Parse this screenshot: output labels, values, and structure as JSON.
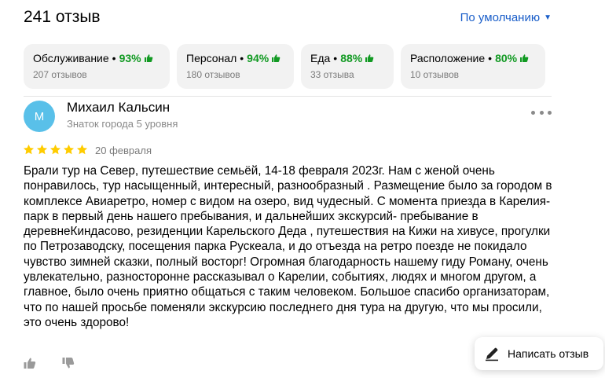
{
  "header": {
    "count_title": "241 отзыв",
    "sort_label": "По умолчанию"
  },
  "categories": [
    {
      "name": "Обслуживание",
      "percent": "93%",
      "count": "207 отзывов"
    },
    {
      "name": "Персонал",
      "percent": "94%",
      "count": "180 отзывов"
    },
    {
      "name": "Еда",
      "percent": "88%",
      "count": "33 отзыва"
    },
    {
      "name": "Расположение",
      "percent": "80%",
      "count": "10 отзывов"
    }
  ],
  "review": {
    "avatar_letter": "М",
    "author": "Михаил Кальсин",
    "level": "Знаток города 5 уровня",
    "rating": 5,
    "date": "20 февраля",
    "text": "Брали тур на Север, путешествие семьёй, 14-18 февраля 2023г. Нам с женой очень понравилось, тур насыщенный, интересный, разнообразный . Размещение было за городом в комплексе Авиаретро, номер с видом на озеро, вид чудесный. С момента приезда в Карелия-парк в первый день нашего пребывания, и дальнейших экскурсий- пребывание в деревнеКиндасово, резиденции Карельского Деда , путешествия на Кижи на хивусе, прогулки по Петрозаводску, посещения парка Рускеала, и до отъезда на ретро поезде не покидало чувство зимней сказки, полный восторг! Огромная благодарность нашему гиду Роману, очень увлекательно, разносторонне рассказывал о Карелии, событиях, людях и многом другом, а главное, было очень приятно общаться с таким человеком. Большое спасибо организаторам, что по нашей просьбе поменяли экскурсию последнего дня тура на другую, что мы просили, это очень здорово!"
  },
  "write_review_label": "Написать отзыв",
  "colors": {
    "accent_link": "#1a5ec9",
    "positive": "#129a23",
    "star": "#fc0",
    "avatar": "#59c0e9"
  },
  "icons": {
    "sort": "chevron-down-icon",
    "thumb": "thumb-up-icon",
    "more": "more-dots-icon",
    "like": "like-icon",
    "dislike": "dislike-icon",
    "write": "pencil-icon"
  }
}
